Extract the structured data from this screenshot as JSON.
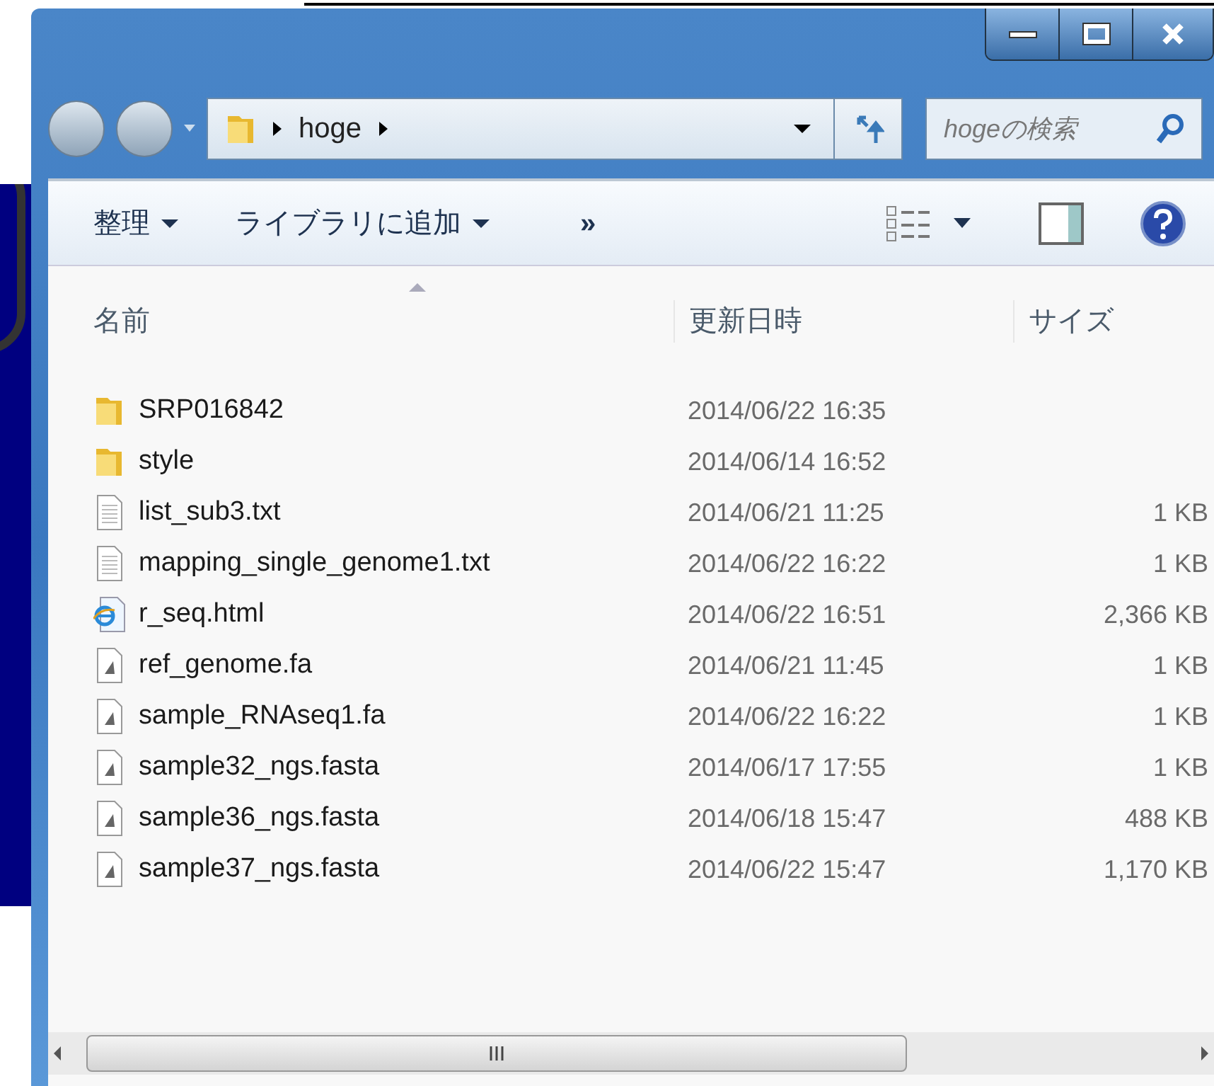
{
  "window": {
    "address": {
      "crumbs": [
        "hoge"
      ]
    },
    "search": {
      "placeholder": "hogeの検索"
    }
  },
  "toolbar": {
    "items": [
      {
        "label": "整理",
        "kind": "menu"
      },
      {
        "label": "ライブラリに追加",
        "kind": "menu"
      },
      {
        "label": "»",
        "kind": "more"
      }
    ]
  },
  "table": {
    "columns": [
      "名前",
      "更新日時",
      "サイズ"
    ],
    "rows": [
      {
        "kind": "folder",
        "name": "SRP016842",
        "date": "2014/06/22 16:35"
      },
      {
        "kind": "folder",
        "name": "style",
        "date": "2014/06/14 16:52"
      },
      {
        "kind": "text",
        "name": "list_sub3.txt",
        "date": "2014/06/21 11:25",
        "size": "1 KB"
      },
      {
        "kind": "text",
        "name": "mapping_single_genome1.txt",
        "date": "2014/06/22 16:22",
        "size": "1 KB"
      },
      {
        "kind": "html",
        "name": "r_seq.html",
        "date": "2014/06/22 16:51",
        "size": "2,366 KB"
      },
      {
        "kind": "fasta",
        "name": "ref_genome.fa",
        "date": "2014/06/21 11:45",
        "size": "1 KB"
      },
      {
        "kind": "fasta",
        "name": "sample_RNAseq1.fa",
        "date": "2014/06/22 16:22",
        "size": "1 KB"
      },
      {
        "kind": "fasta",
        "name": "sample32_ngs.fasta",
        "date": "2014/06/17 17:55",
        "size": "1 KB"
      },
      {
        "kind": "fasta",
        "name": "sample36_ngs.fasta",
        "date": "2014/06/18 15:47",
        "size": "488 KB"
      },
      {
        "kind": "fasta",
        "name": "sample37_ngs.fasta",
        "date": "2014/06/22 15:47",
        "size": "1,170 KB"
      }
    ]
  }
}
